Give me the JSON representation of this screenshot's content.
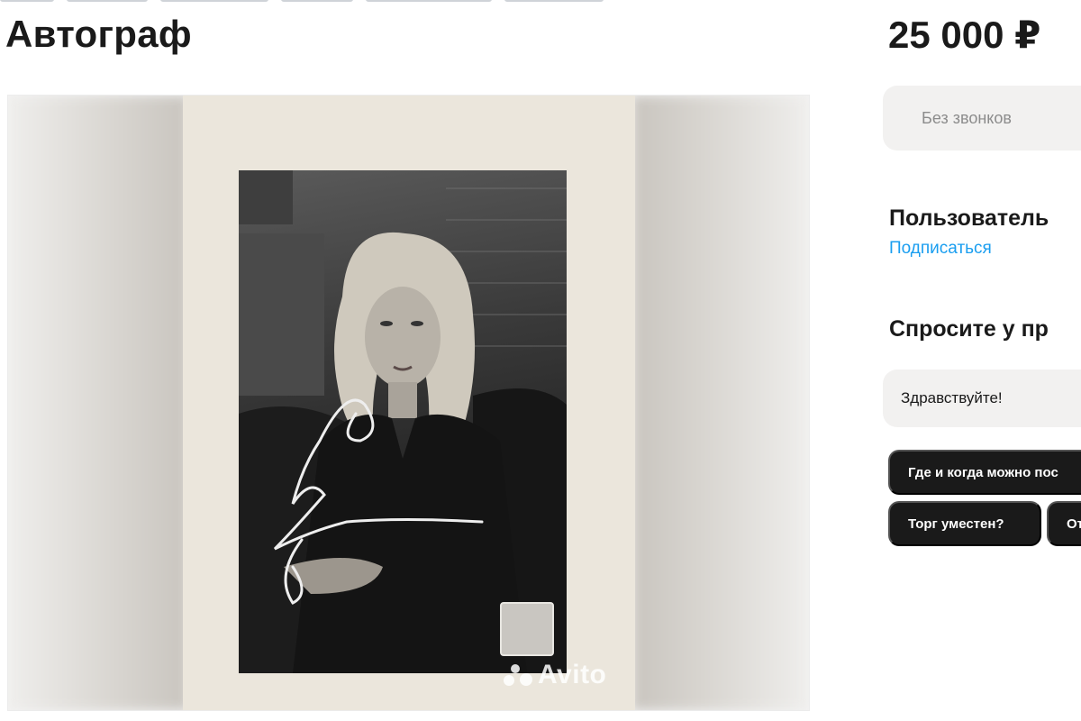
{
  "listing": {
    "title": "Автограф",
    "price": "25 000 ₽"
  },
  "gallery": {
    "watermark": "Avito"
  },
  "contact": {
    "no_calls_label": "Без звонков"
  },
  "seller": {
    "name": "Пользователь",
    "subscribe_label": "Подписаться"
  },
  "ask": {
    "title": "Спросите у пр",
    "message_value": "Здравствуйте!",
    "quick_questions": [
      "Где и когда можно пос",
      "Торг уместен?",
      "От"
    ]
  },
  "colors": {
    "link": "#1a9ef0",
    "chip_bg": "#1a1a1a",
    "field_bg": "#f2f1f0"
  }
}
